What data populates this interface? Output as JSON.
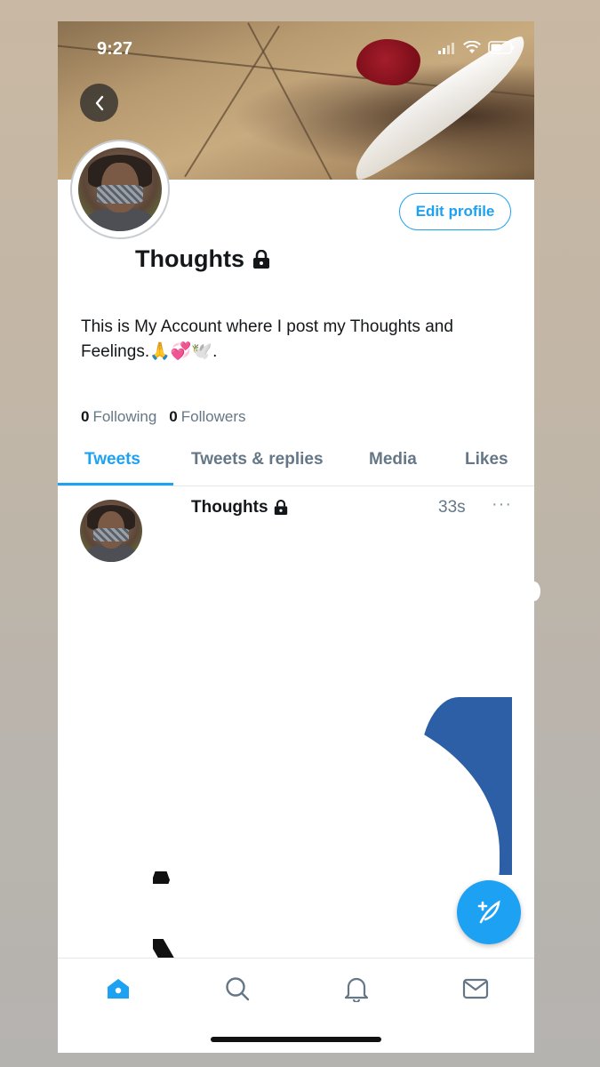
{
  "status_bar": {
    "time": "9:27"
  },
  "profile": {
    "display_name": "Thoughts",
    "edit_profile_label": "Edit profile",
    "bio": "This is My Account where I post my Thoughts and Feelings.🙏💞🕊️.",
    "following_count": "0",
    "following_label": "Following",
    "followers_count": "0",
    "followers_label": "Followers"
  },
  "tabs": [
    {
      "label": "Tweets",
      "active": true
    },
    {
      "label": "Tweets & replies",
      "active": false
    },
    {
      "label": "Media",
      "active": false
    },
    {
      "label": "Likes",
      "active": false
    }
  ],
  "tweet": {
    "author": "Thoughts",
    "time": "33s",
    "more": "···"
  },
  "bottom_nav": [
    "home-icon",
    "search-icon",
    "bell-icon",
    "mail-icon"
  ],
  "colors": {
    "accent": "#1da1f2",
    "text": "#14171a",
    "muted": "#657786"
  }
}
